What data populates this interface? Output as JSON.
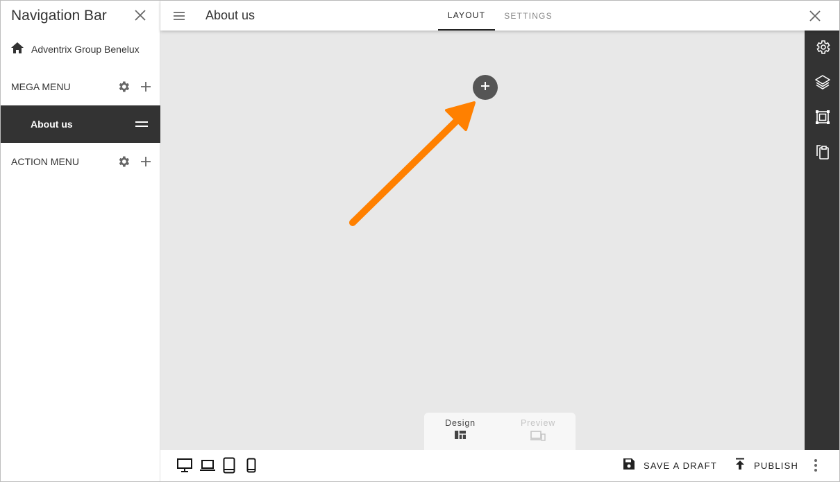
{
  "left_panel": {
    "title": "Navigation Bar",
    "site": {
      "label": "Adventrix Group Benelux",
      "icon": "home-icon"
    },
    "sections": [
      {
        "label": "MEGA MENU"
      },
      {
        "label": "ACTION MENU"
      }
    ],
    "active_item": {
      "label": "About us"
    }
  },
  "header": {
    "title": "About us",
    "tabs": [
      {
        "label": "LAYOUT",
        "active": true
      },
      {
        "label": "SETTINGS",
        "active": false
      }
    ]
  },
  "canvas": {
    "add_button_icon": "plus-icon",
    "annotation_color": "#ff8000"
  },
  "mode_switch": {
    "design_label": "Design",
    "preview_label": "Preview",
    "selected": "Design"
  },
  "right_toolbar": {
    "icons": [
      "gear-icon",
      "layers-icon",
      "frame-icon",
      "clipboard-icon"
    ]
  },
  "bottom_bar": {
    "devices": [
      "desktop-icon",
      "laptop-icon",
      "tablet-icon",
      "mobile-icon"
    ],
    "save_label": "SAVE A DRAFT",
    "publish_label": "PUBLISH"
  },
  "colors": {
    "dark": "#333333",
    "canvas_bg": "#e8e8e8",
    "accent_arrow": "#ff8000"
  }
}
